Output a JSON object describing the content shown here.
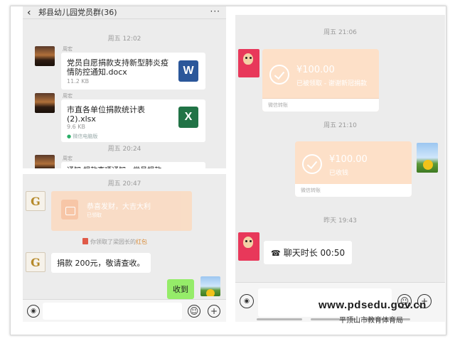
{
  "panel_top": {
    "title": "郏县幼儿园党员群(36)",
    "messages": [
      {
        "time": "周五 12:02",
        "sender": "周宏",
        "file_name": "党员自愿捐款支持新型肺炎疫情防控通知.docx",
        "file_size": "11.2 KB",
        "file_type": "W"
      },
      {
        "sender": "周宏",
        "file_name": "市直各单位捐款统计表(2).xlsx",
        "file_size": "9.6 KB",
        "file_type": "X",
        "source": "微信电脑版"
      },
      {
        "time": "周五 20:24",
        "sender": "周宏",
        "text": "通知 捐款事项通知，党员捐款"
      }
    ]
  },
  "panel_left_bottom": {
    "time": "周五 20:47",
    "red_packet": {
      "title": "恭喜发财，大吉大利",
      "status": "已领取"
    },
    "notice_prefix": "你领取了梁园长的",
    "notice_highlight": "红包",
    "message": "捐款 200元，敬请查收。",
    "reply": "收到"
  },
  "panel_right": {
    "transfers": [
      {
        "time": "周五 21:06",
        "amount": "¥100.00",
        "status": "已被领取 - 谢谢新冠捐款",
        "footer": "微信转账"
      },
      {
        "time": "周五 21:10",
        "amount": "¥100.00",
        "status": "已收钱",
        "footer": "微信转账"
      }
    ],
    "call": {
      "time": "昨天 19:43",
      "text": "聊天时长 00:50"
    }
  },
  "watermark": {
    "url": "www.pdsedu.gov.cn",
    "org": "平顶山市教育体育局"
  },
  "colors": {
    "chat_bg": "#ececec",
    "bubble_green": "#95ec69",
    "transfer_orange": "#fde0c8",
    "word_blue": "#2b579a",
    "excel_green": "#217346"
  }
}
